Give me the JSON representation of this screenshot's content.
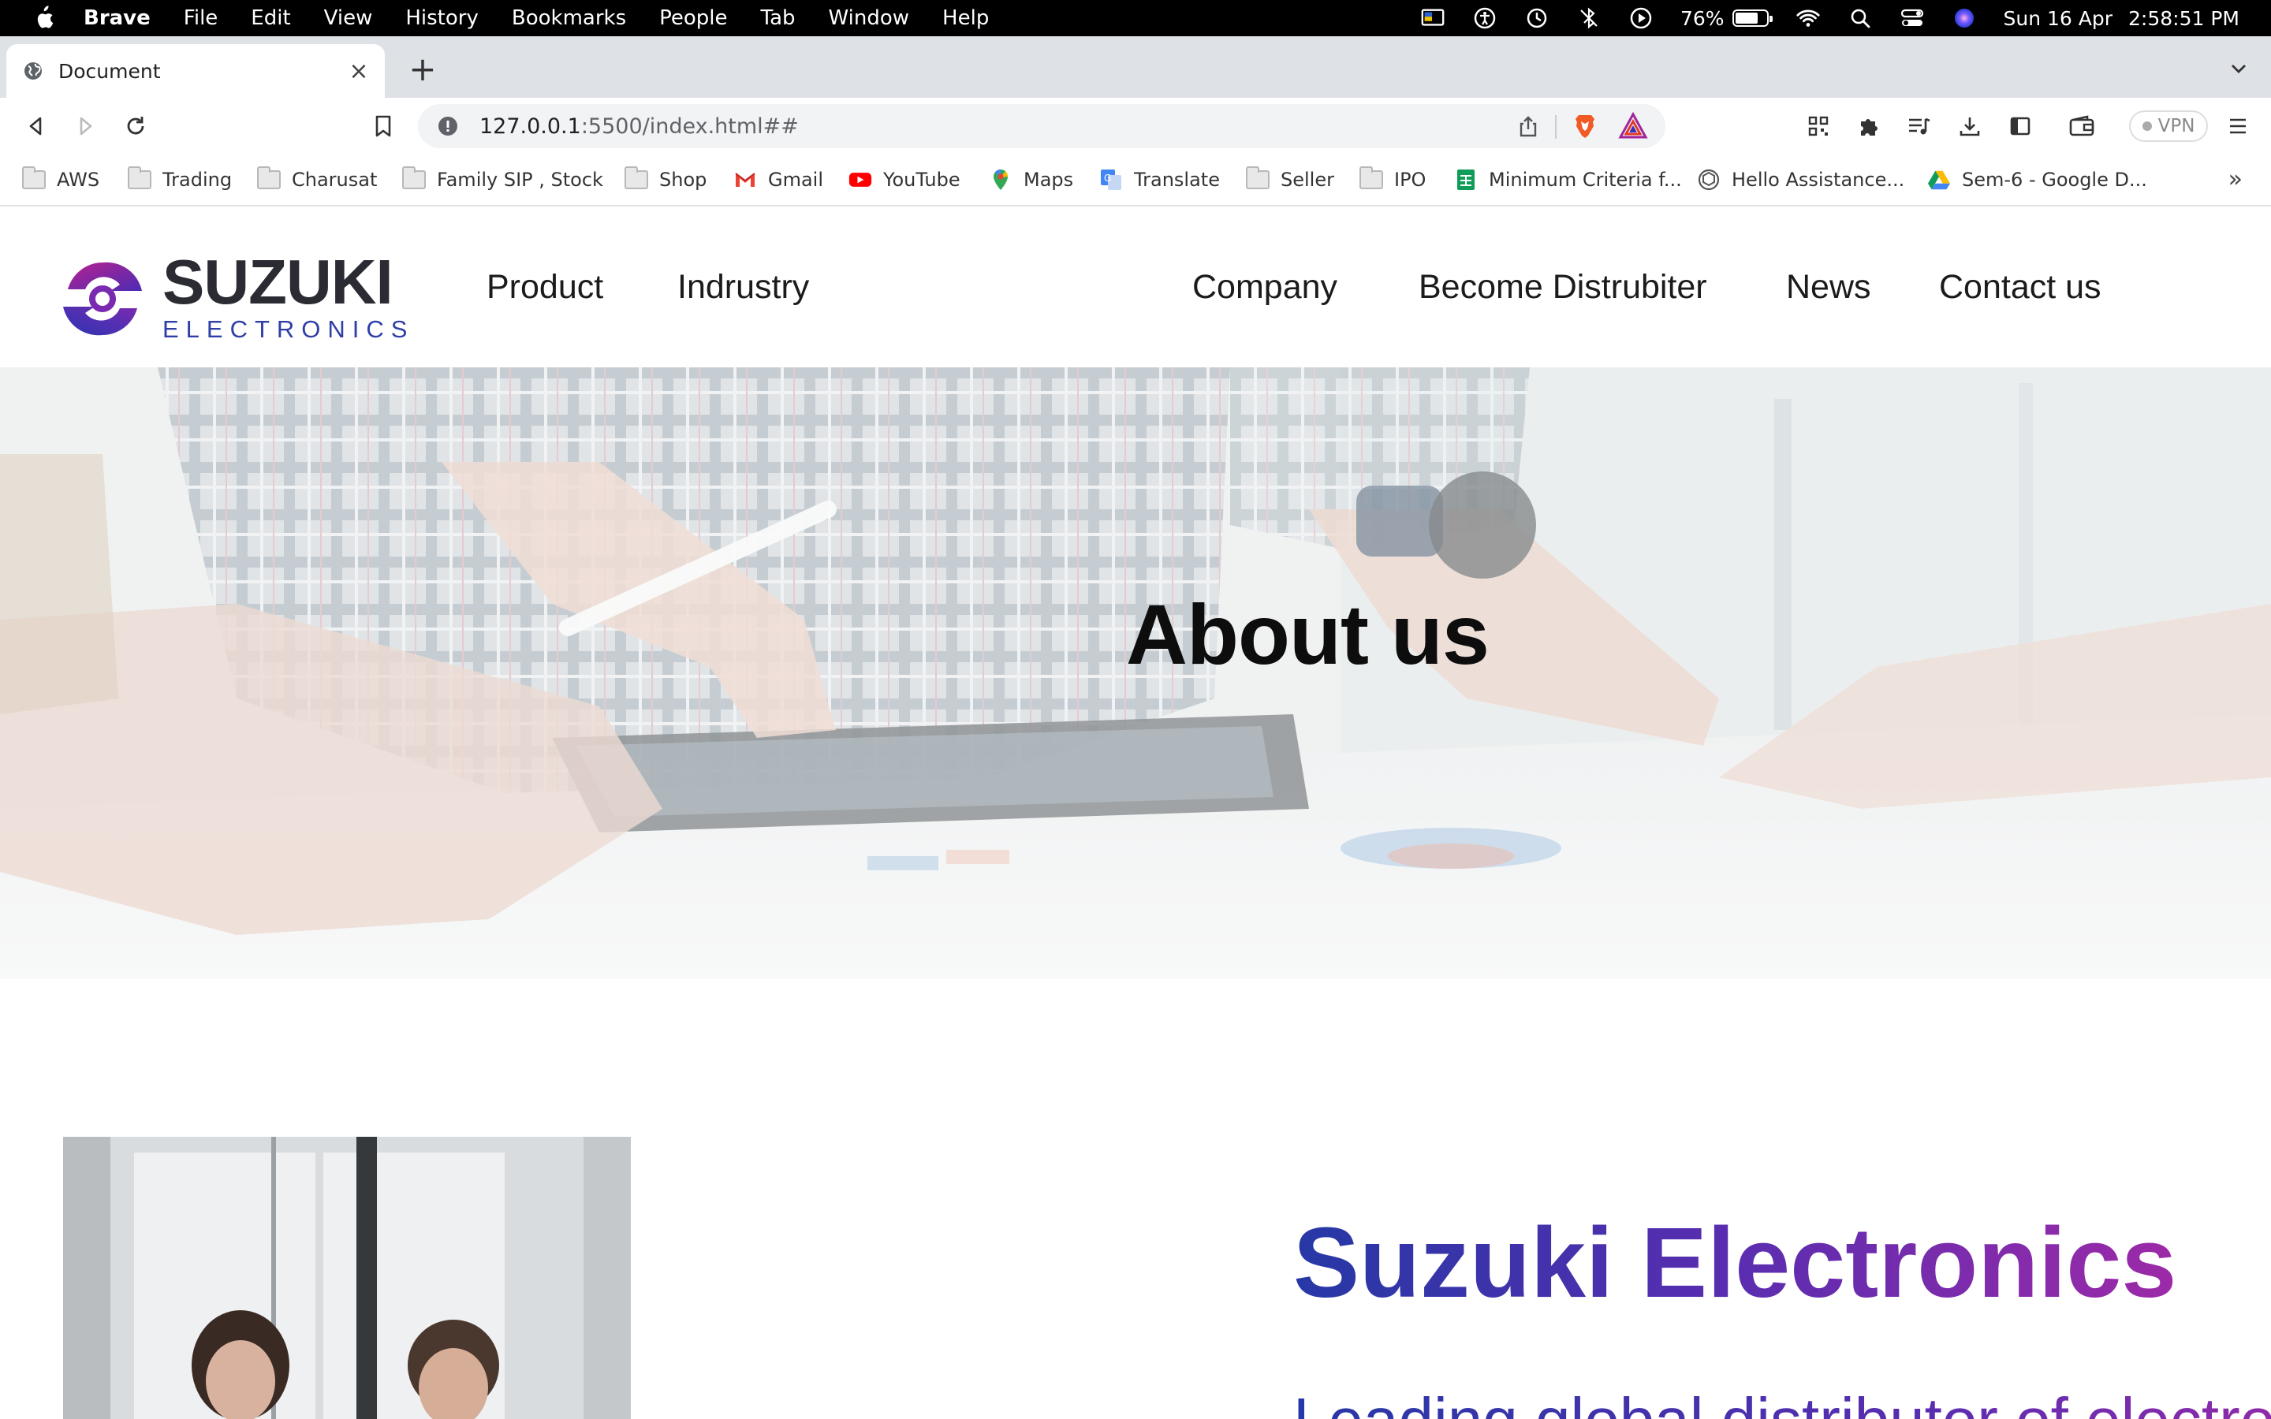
{
  "menubar": {
    "app_name": "Brave",
    "items": [
      "File",
      "Edit",
      "View",
      "History",
      "Bookmarks",
      "People",
      "Tab",
      "Window",
      "Help"
    ],
    "battery_percent": "76%",
    "battery_level": 0.76,
    "date": "Sun 16 Apr",
    "time": "2:58:51 PM"
  },
  "browser": {
    "tab_title": "Document",
    "url_host": "127.0.0.1",
    "url_path": ":5500/index.html##",
    "vpn_label": "VPN"
  },
  "bookmarks": [
    {
      "label": "AWS",
      "icon": "folder-icon"
    },
    {
      "label": "Trading",
      "icon": "folder-icon"
    },
    {
      "label": "Charusat",
      "icon": "folder-icon"
    },
    {
      "label": "Family SIP , Stock",
      "icon": "folder-icon"
    },
    {
      "label": "Shop",
      "icon": "folder-icon"
    },
    {
      "label": "Gmail",
      "icon": "gmail-icon"
    },
    {
      "label": "YouTube",
      "icon": "youtube-icon"
    },
    {
      "label": "Maps",
      "icon": "maps-icon"
    },
    {
      "label": "Translate",
      "icon": "translate-icon"
    },
    {
      "label": "Seller",
      "icon": "folder-icon"
    },
    {
      "label": "IPO",
      "icon": "folder-icon"
    },
    {
      "label": "Minimum Criteria f...",
      "icon": "sheets-icon"
    },
    {
      "label": "Hello Assistance...",
      "icon": "openai-icon"
    },
    {
      "label": "Sem-6 - Google D...",
      "icon": "drive-icon"
    }
  ],
  "site": {
    "logo": {
      "name": "SUZUKI",
      "sub": "ELECTRONICS"
    },
    "nav": [
      "Product",
      "Indrustry",
      "Company",
      "Become Distrubiter",
      "News",
      "Contact us"
    ],
    "hero_title": "About us",
    "about_heading": "Suzuki Electronics",
    "about_subheading": "Leading global distributor of electronic"
  },
  "colors": {
    "brand_blue": "#2638a6",
    "brand_purple": "#9c2aa8",
    "browser_chrome": "#dee1e6"
  }
}
